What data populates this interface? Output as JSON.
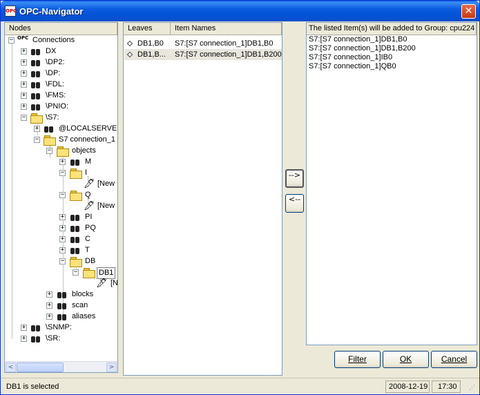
{
  "window": {
    "title": "OPC-Navigator",
    "app_icon": "opc-navigator-icon",
    "close_glyph": "✕"
  },
  "tree": {
    "header": "Nodes",
    "root": {
      "label": "Connections",
      "logo": "OPC"
    },
    "nodes": {
      "dx": "DX",
      "dp2": "\\DP2:",
      "dp": "\\DP:",
      "fdl": "\\FDL:",
      "fms": "\\FMS:",
      "pnio": "\\PNIO:",
      "s7": "\\S7:",
      "localserver": "@LOCALSERVER",
      "s7conn": "S7 connection_1",
      "objects": "objects",
      "m": "M",
      "i": "I",
      "i_new": "[New",
      "q": "Q",
      "q_new": "[New",
      "pi": "PI",
      "pq": "PQ",
      "c": "C",
      "t": "T",
      "db": "DB",
      "db1": "DB1",
      "db1_new": "[N",
      "blocks": "blocks",
      "scan": "scan",
      "aliases": "aliases",
      "snmp": "\\SNMP:",
      "sr": "\\SR:"
    },
    "scroll_left": "<",
    "scroll_right": ">"
  },
  "list": {
    "col_leaves": "Leaves",
    "col_item_names": "Item Names",
    "rows": [
      {
        "leaf": "DB1,B0",
        "item": "S7:[S7 connection_1]DB1,B0"
      },
      {
        "leaf": "DB1,B...",
        "item": "S7:[S7 connection_1]DB1,B200"
      }
    ]
  },
  "transfer": {
    "add_label": "-->",
    "remove_label": "<--"
  },
  "added": {
    "header": "The listed Item(s) will be added to Group: cpu224",
    "items": [
      "S7:[S7 connection_1]DB1,B0",
      "S7:[S7 connection_1]DB1,B200",
      "S7:[S7 connection_1]IB0",
      "S7:[S7 connection_1]QB0"
    ]
  },
  "buttons": {
    "filter": "Filter",
    "ok": "OK",
    "cancel": "Cancel"
  },
  "status": {
    "message": "DB1 is selected",
    "date": "2008-12-19",
    "time": "17:30"
  }
}
